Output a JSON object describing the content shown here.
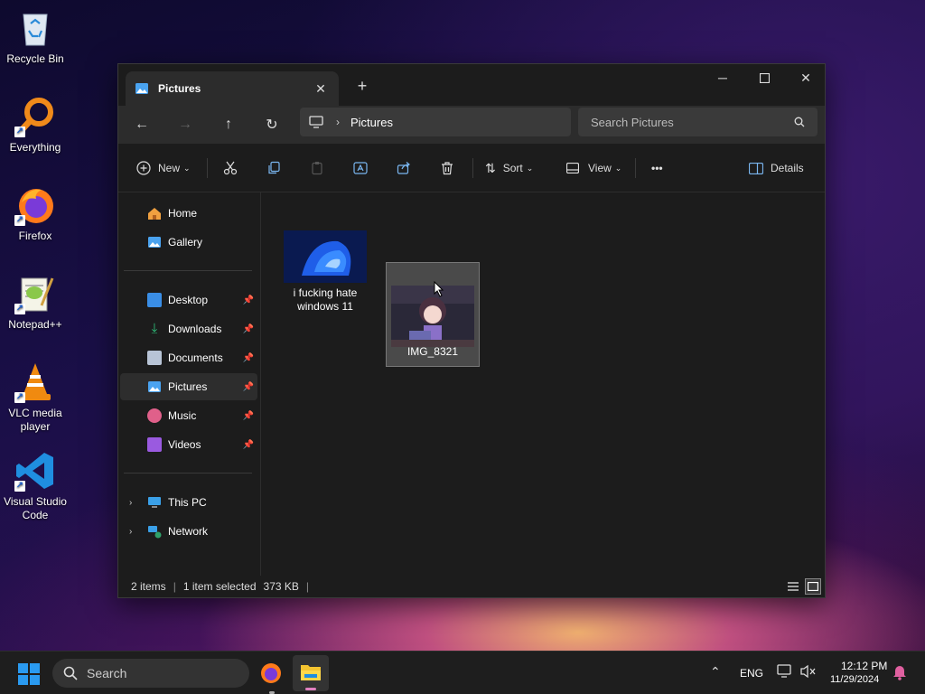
{
  "desktop": {
    "icons": [
      {
        "label": "Recycle Bin"
      },
      {
        "label": "Everything"
      },
      {
        "label": "Firefox"
      },
      {
        "label": "Notepad++"
      },
      {
        "label": "VLC media player"
      },
      {
        "label": "Visual Studio Code"
      }
    ]
  },
  "window": {
    "tab_title": "Pictures",
    "new_tab_symbol": "+",
    "controls": {
      "minimize": "─",
      "maximize": "☐",
      "close": "✕"
    },
    "breadcrumb": "Pictures",
    "search_placeholder": "Search Pictures",
    "toolbar": {
      "new_label": "New",
      "sort_label": "Sort",
      "view_label": "View",
      "more_label": "•••",
      "details_label": "Details"
    },
    "sidebar": {
      "home": "Home",
      "gallery": "Gallery",
      "quick_access": [
        {
          "label": "Desktop",
          "color": "#3a8ee6"
        },
        {
          "label": "Downloads",
          "color": "#2fbf7a"
        },
        {
          "label": "Documents",
          "color": "#b8c4d6"
        },
        {
          "label": "Pictures",
          "color": "#4aa3f0"
        },
        {
          "label": "Music",
          "color": "#e0608a"
        },
        {
          "label": "Videos",
          "color": "#9a5ae0"
        }
      ],
      "this_pc": "This PC",
      "network": "Network"
    },
    "files": [
      {
        "name": "i fucking hate windows 11",
        "selected": false
      },
      {
        "name": "IMG_8321",
        "selected": true
      }
    ],
    "status": {
      "items": "2 items",
      "selected": "1 item selected",
      "size": "373 KB"
    }
  },
  "taskbar": {
    "search_label": "Search",
    "language": "ENG",
    "time": "12:12 PM",
    "date": "11/29/2024"
  },
  "colors": {
    "accent": "#4aa3f0",
    "window_bg": "#1c1c1c",
    "nav_bg": "#2c2c2c"
  }
}
